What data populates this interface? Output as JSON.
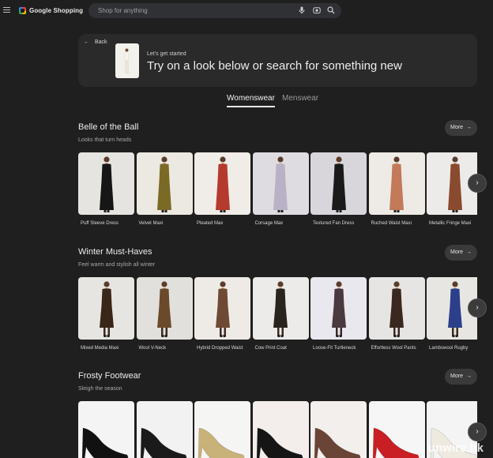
{
  "app": {
    "brand": "Google Shopping"
  },
  "search": {
    "placeholder": "Shop for anything",
    "icons": [
      "mic-icon",
      "lens-icon",
      "search-icon"
    ]
  },
  "hero": {
    "back_label": "Back",
    "kicker": "Let's get started",
    "title": "Try on a look below or search for something new"
  },
  "tabs": [
    {
      "label": "Womenswear",
      "selected": true
    },
    {
      "label": "Menswear",
      "selected": false
    }
  ],
  "sections": [
    {
      "title": "Belle of the Ball",
      "subtitle": "Looks that turn heads",
      "more_label": "More",
      "items": [
        {
          "name": "Puff Sleeve Dress",
          "bg": "#e6e4e1",
          "color": "#161616"
        },
        {
          "name": "Velvet Maxi",
          "bg": "#ece9e2",
          "color": "#7a6a26"
        },
        {
          "name": "Pleated Max",
          "bg": "#f0ece8",
          "color": "#b53a2e"
        },
        {
          "name": "Corsage Max",
          "bg": "#dfdce1",
          "color": "#b9b2c6"
        },
        {
          "name": "Textured Fan Dress",
          "bg": "#d8d6db",
          "color": "#1a1a1a"
        },
        {
          "name": "Ruched Waist Maxi",
          "bg": "#eeeae6",
          "color": "#c27a58"
        },
        {
          "name": "Metallic Fringe Maxi",
          "bg": "#ecebea",
          "color": "#8a4a30"
        }
      ]
    },
    {
      "title": "Winter Must-Haves",
      "subtitle": "Feel warm and stylish all winter",
      "more_label": "More",
      "items": [
        {
          "name": "Mixed Media Maxi",
          "bg": "#e7e5e2",
          "color": "#3a2618"
        },
        {
          "name": "Wool V-Neck",
          "bg": "#e2e0dc",
          "color": "#6b4a2c"
        },
        {
          "name": "Hybrid Dropped Waist",
          "bg": "#eeebe7",
          "color": "#6e4a34"
        },
        {
          "name": "Cow Print Coat",
          "bg": "#ecebe9",
          "color": "#2a241e"
        },
        {
          "name": "Loose-Fit Turtleneck",
          "bg": "#e9e8ee",
          "color": "#4a3a40"
        },
        {
          "name": "Effortless Wool Pants",
          "bg": "#e6e5e3",
          "color": "#3a2820"
        },
        {
          "name": "Lambswool Rugby",
          "bg": "#e8e6e2",
          "color": "#2c3f8a"
        }
      ]
    },
    {
      "title": "Frosty Footwear",
      "subtitle": "Sleigh the season",
      "more_label": "More",
      "items": [
        {
          "name": "",
          "bg": "#f4f4f4",
          "color": "#111111"
        },
        {
          "name": "",
          "bg": "#f2f2f2",
          "color": "#1a1a1a"
        },
        {
          "name": "",
          "bg": "#f5f5f3",
          "color": "#c8b27a"
        },
        {
          "name": "",
          "bg": "#f3eeec",
          "color": "#151515"
        },
        {
          "name": "",
          "bg": "#f2efed",
          "color": "#6a4436"
        },
        {
          "name": "",
          "bg": "#f6f6f6",
          "color": "#c81e24"
        },
        {
          "name": "",
          "bg": "#f4f4f4",
          "color": "#efeae0"
        }
      ]
    }
  ],
  "watermark": "unwire.hk"
}
